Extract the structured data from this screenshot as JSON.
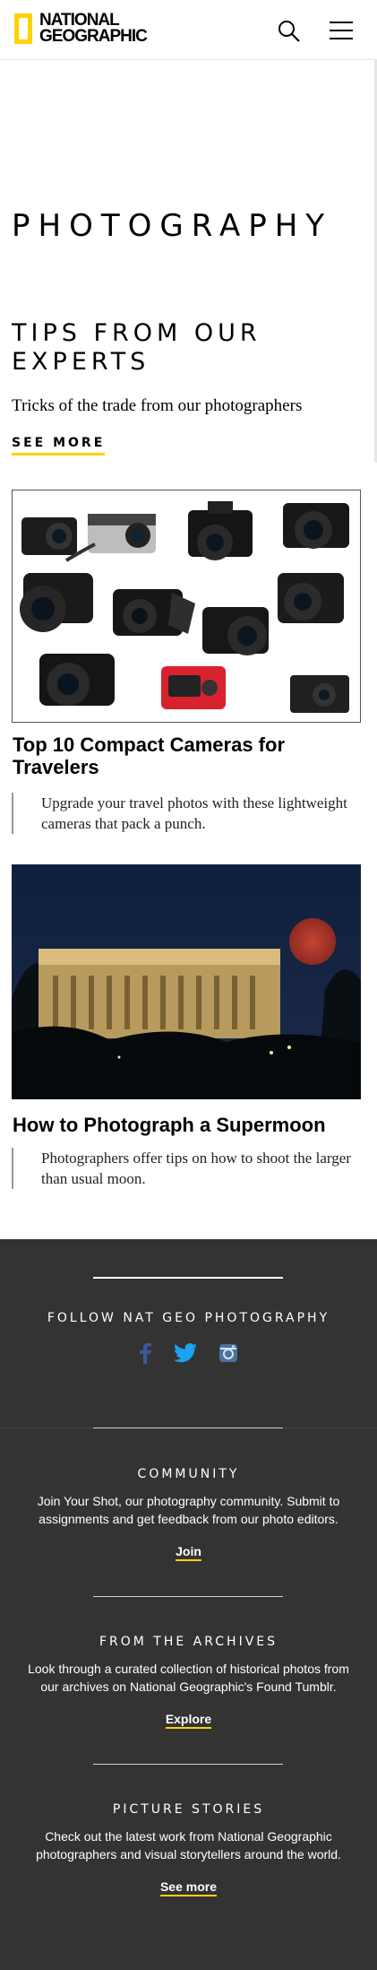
{
  "header": {
    "logo_line1": "NATIONAL",
    "logo_line2": "GEOGRAPHIC",
    "logo_color": "#ffd200",
    "search_icon": "search-icon",
    "menu_icon": "hamburger-menu-icon"
  },
  "page": {
    "title": "PHOTOGRAPHY"
  },
  "section": {
    "heading": "TIPS FROM OUR EXPERTS",
    "dek": "Tricks of the trade from our photographers",
    "see_more": "SEE MORE"
  },
  "articles": [
    {
      "title": "Top 10 Compact Cameras for Travelers",
      "dek": "Upgrade your travel photos with these lightweight cameras that pack a punch."
    },
    {
      "title": "How to Photograph a Supermoon",
      "dek": "Photographers offer tips on how to shoot the larger than usual moon."
    }
  ],
  "footer": {
    "follow_heading": "FOLLOW NAT GEO PHOTOGRAPHY",
    "social_icons": [
      "facebook-icon",
      "twitter-icon",
      "instagram-icon"
    ],
    "blocks": [
      {
        "heading": "COMMUNITY",
        "text": "Join Your Shot, our photography community. Submit to assignments and get feedback from our photo editors.",
        "link": "Join"
      },
      {
        "heading": "FROM THE ARCHIVES",
        "text": "Look through a curated collection of historical photos from our archives on National Geographic's Found Tumblr.",
        "link": "Explore"
      },
      {
        "heading": "PICTURE STORIES",
        "text": "Check out the latest work from National Geographic photographers and visual storytellers around the world.",
        "link": "See more"
      }
    ],
    "background": "#333333",
    "accent": "#ffd200"
  }
}
